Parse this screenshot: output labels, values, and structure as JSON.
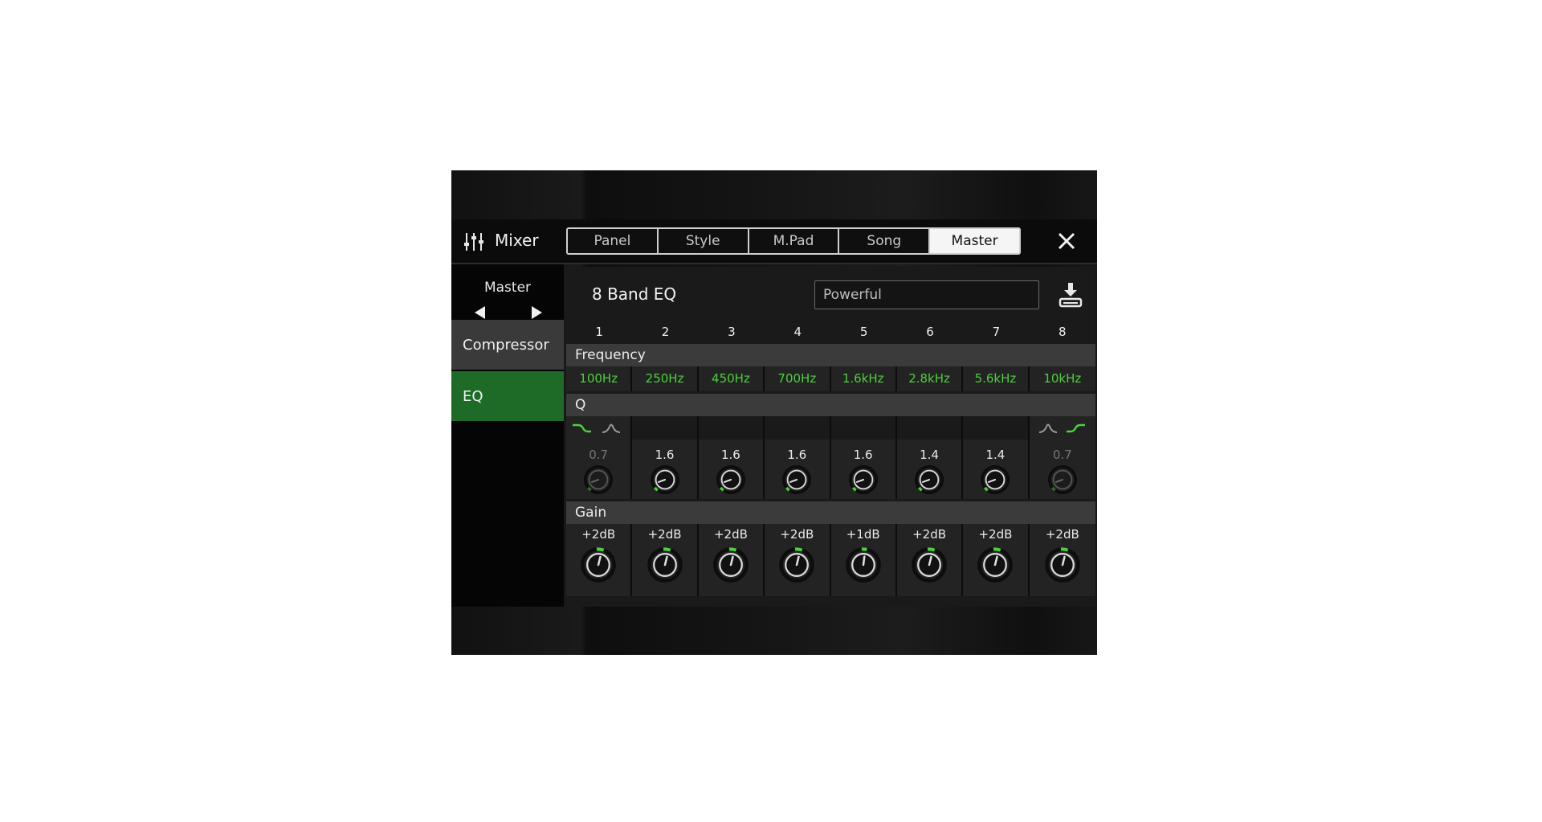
{
  "header": {
    "title": "Mixer",
    "tabs": [
      "Panel",
      "Style",
      "M.Pad",
      "Song",
      "Master"
    ],
    "active_tab": "Master"
  },
  "sidebar": {
    "part_label": "Master",
    "items": [
      "Compressor",
      "EQ"
    ],
    "selected": "EQ"
  },
  "eq": {
    "title": "8 Band EQ",
    "preset": "Powerful",
    "band_numbers": [
      "1",
      "2",
      "3",
      "4",
      "5",
      "6",
      "7",
      "8"
    ],
    "sections": {
      "frequency": "Frequency",
      "q": "Q",
      "gain": "Gain"
    },
    "frequencies": [
      "100Hz",
      "250Hz",
      "450Hz",
      "700Hz",
      "1.6kHz",
      "2.8kHz",
      "5.6kHz",
      "10kHz"
    ],
    "q_values": [
      "0.7",
      "1.6",
      "1.6",
      "1.6",
      "1.6",
      "1.4",
      "1.4",
      "0.7"
    ],
    "q_enabled": [
      false,
      true,
      true,
      true,
      true,
      true,
      true,
      false
    ],
    "gains": [
      "+2dB",
      "+2dB",
      "+2dB",
      "+2dB",
      "+1dB",
      "+2dB",
      "+2dB",
      "+2dB"
    ],
    "band1_shape": {
      "selected": "shelving",
      "options": [
        "shelving-low-icon",
        "peaking-icon"
      ]
    },
    "band8_shape": {
      "selected": "shelving",
      "options": [
        "peaking-icon",
        "shelving-high-icon"
      ]
    }
  },
  "colors": {
    "accent_green": "#4cd03c",
    "selected_bg": "#1e6b28"
  },
  "icons": [
    "mixer-sliders-icon",
    "close-icon",
    "arrow-left-icon",
    "arrow-right-icon",
    "save-icon",
    "knob-icon"
  ]
}
